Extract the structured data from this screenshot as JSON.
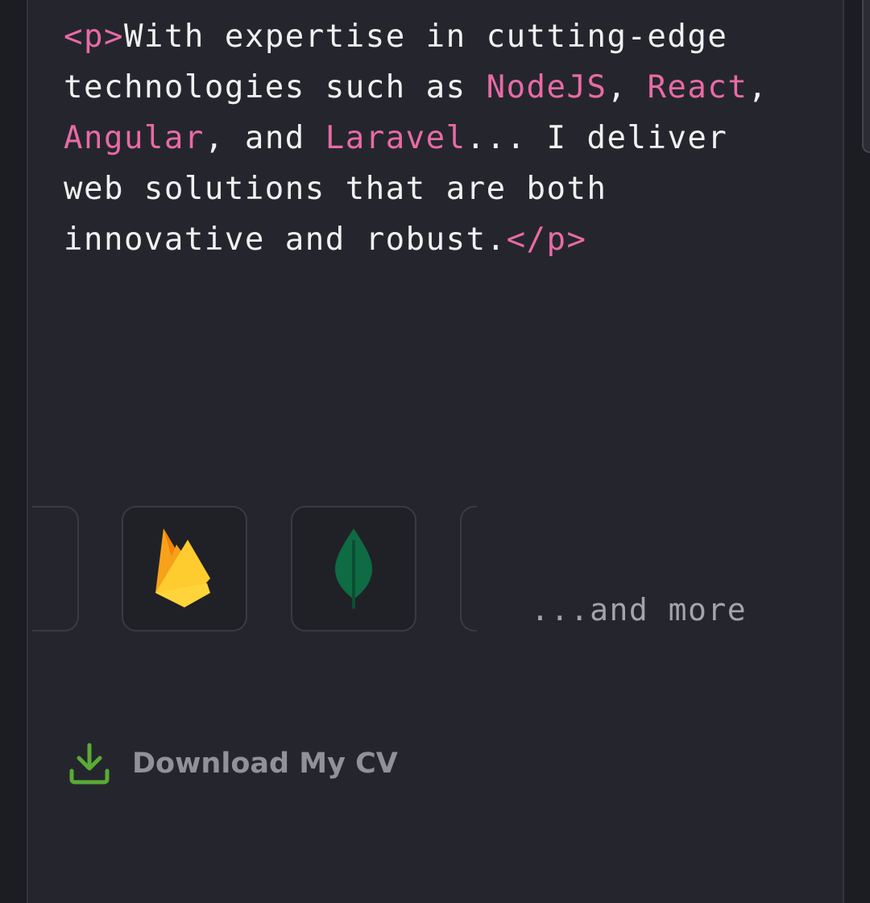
{
  "intro": {
    "open_tag": "<p>",
    "text_1": "With expertise in cutting-edge technologies such as ",
    "tech_1": "NodeJS",
    "sep_1": ", ",
    "tech_2": "React",
    "sep_2": ", ",
    "tech_3": "Angular",
    "sep_3": ", and ",
    "tech_4": "Laravel",
    "text_2": "... I deliver web solutions that are both innovative and robust.",
    "close_tag": "</p>"
  },
  "tech_icons": [
    {
      "icon": "firebase-icon"
    },
    {
      "icon": "mongodb-icon"
    }
  ],
  "more_text": "...and more",
  "cv": {
    "label": "Download My CV",
    "icon": "download-icon"
  },
  "colors": {
    "accent": "#e86aa6",
    "download_green": "#5aab35",
    "card_bg": "#25262d",
    "page_bg": "#1c1d22"
  }
}
